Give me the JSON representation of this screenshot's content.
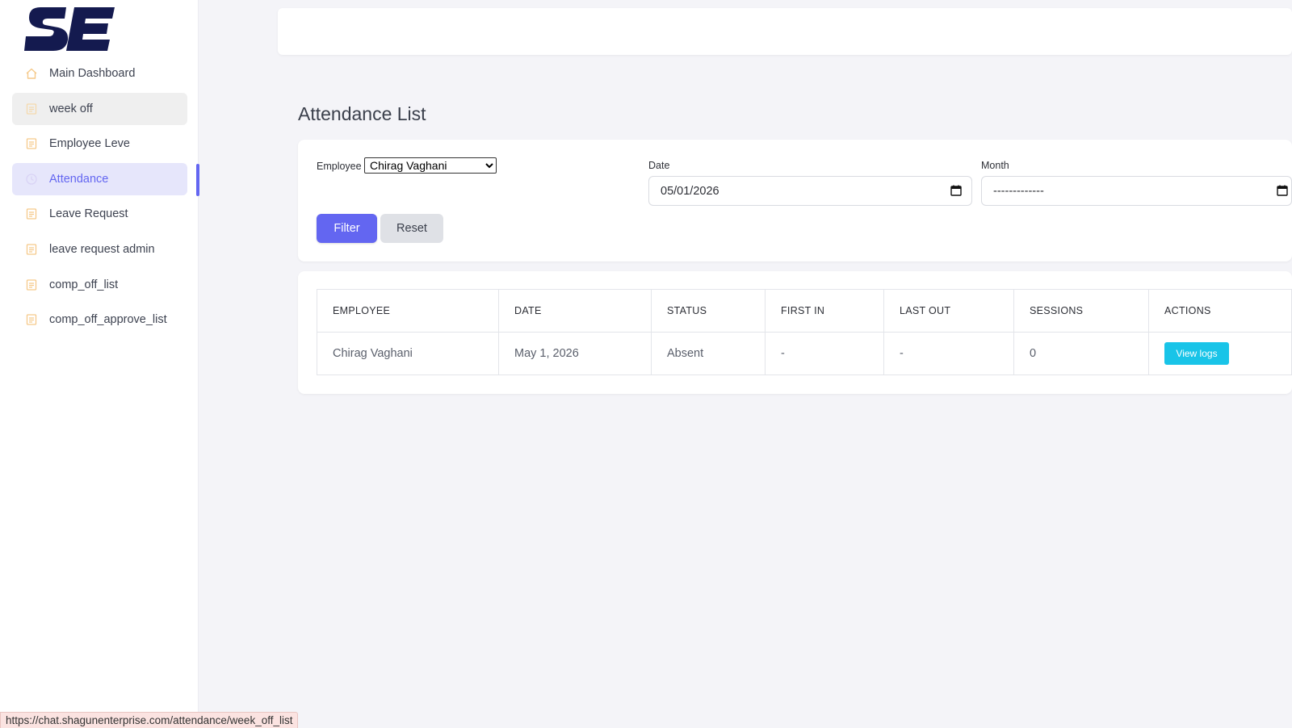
{
  "logo": {
    "text": "SE"
  },
  "sidebar": {
    "items": [
      {
        "label": "Main Dashboard",
        "icon": "home-icon"
      },
      {
        "label": "week off",
        "icon": "document-icon"
      },
      {
        "label": "Employee Leve",
        "icon": "document-icon"
      },
      {
        "label": "Attendance",
        "icon": "clock-icon"
      },
      {
        "label": "Leave Request",
        "icon": "document-icon"
      },
      {
        "label": "leave request admin",
        "icon": "document-icon"
      },
      {
        "label": "comp_off_list",
        "icon": "document-icon"
      },
      {
        "label": "comp_off_approve_list",
        "icon": "document-icon"
      }
    ],
    "active_index": 3,
    "hover_index": 1,
    "icon_color": "#f5c98a",
    "accent_color": "#6366f1"
  },
  "page": {
    "title": "Attendance List"
  },
  "filters": {
    "employee_label": "Employee",
    "employee_selected": "Chirag Vaghani",
    "date_label": "Date",
    "date_value": "05/01/2026",
    "month_label": "Month",
    "month_value": "-------------",
    "filter_button": "Filter",
    "reset_button": "Reset"
  },
  "table": {
    "headers": [
      "EMPLOYEE",
      "DATE",
      "STATUS",
      "FIRST IN",
      "LAST OUT",
      "SESSIONS",
      "ACTIONS"
    ],
    "rows": [
      {
        "employee": "Chirag Vaghani",
        "date": "May 1, 2026",
        "status": "Absent",
        "first_in": "-",
        "last_out": "-",
        "sessions": "0",
        "action": "View logs"
      }
    ]
  },
  "status_bar": {
    "url": "https://chat.shagunenterprise.com/attendance/week_off_list"
  }
}
